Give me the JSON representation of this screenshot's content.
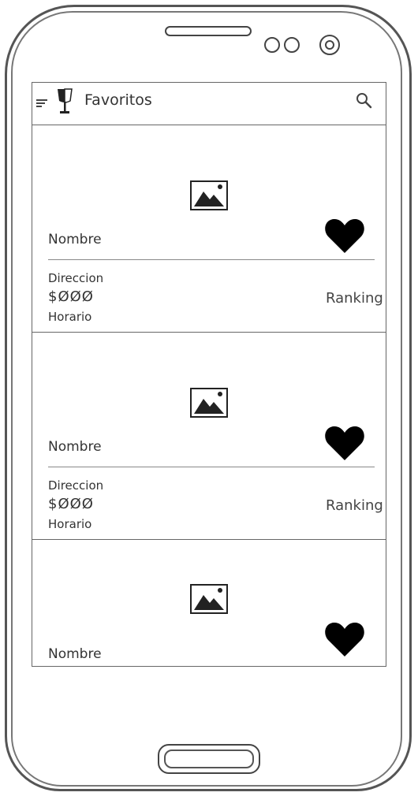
{
  "app": {
    "title": "Favoritos"
  },
  "icons": {
    "menu": "hamburger-menu-icon",
    "logo": "wine-glass-icon",
    "search": "search-icon",
    "image": "image-placeholder-icon",
    "favorite": "heart-icon"
  },
  "colors": {
    "heart": "#000000",
    "text": "#333333",
    "border": "#666666"
  },
  "favorites": [
    {
      "name": "Nombre",
      "address": "Direccion",
      "price": "$ØØØ",
      "hours": "Horario",
      "ranking": "Ranking"
    },
    {
      "name": "Nombre",
      "address": "Direccion",
      "price": "$ØØØ",
      "hours": "Horario",
      "ranking": "Ranking"
    },
    {
      "name": "Nombre"
    }
  ]
}
